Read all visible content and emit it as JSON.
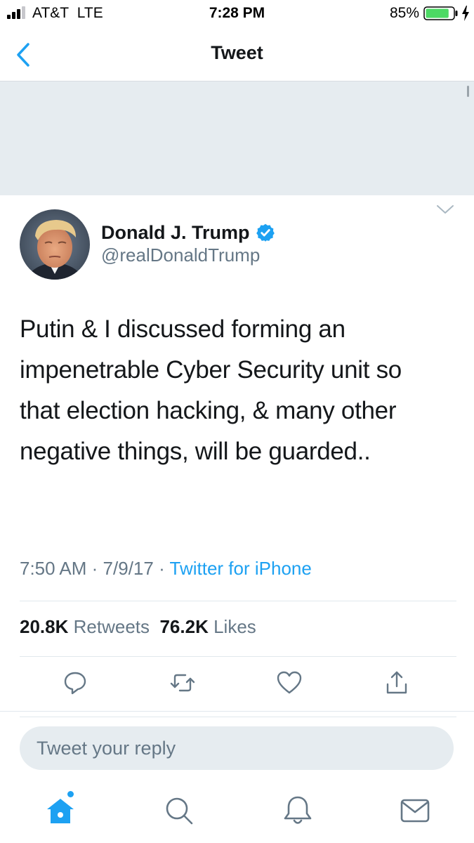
{
  "status_bar": {
    "carrier": "AT&T",
    "network": "LTE",
    "time": "7:28 PM",
    "battery_percent": "85%",
    "battery_level": 0.85,
    "battery_color": "#4cd964"
  },
  "nav": {
    "title": "Tweet",
    "back_icon": "chevron-left-icon"
  },
  "tweet": {
    "display_name": "Donald J. Trump",
    "verified": true,
    "handle": "@realDonaldTrump",
    "text": "Putin & I discussed forming an impenetrable Cyber Security unit so that election hacking, & many other negative things, will be guarded..",
    "time": "7:50 AM",
    "date": "7/9/17",
    "source": "Twitter for iPhone",
    "separator": "·"
  },
  "stats": {
    "retweets_count": "20.8K",
    "retweets_label": "Retweets",
    "likes_count": "76.2K",
    "likes_label": "Likes"
  },
  "actions": [
    {
      "name": "reply",
      "icon": "reply-icon"
    },
    {
      "name": "retweet",
      "icon": "retweet-icon"
    },
    {
      "name": "like",
      "icon": "heart-icon"
    },
    {
      "name": "share",
      "icon": "share-icon"
    }
  ],
  "reply": {
    "placeholder": "Tweet your reply"
  },
  "tab_bar": [
    {
      "name": "home",
      "icon": "home-icon",
      "active": true
    },
    {
      "name": "search",
      "icon": "search-icon",
      "active": false
    },
    {
      "name": "notifications",
      "icon": "bell-icon",
      "active": false
    },
    {
      "name": "messages",
      "icon": "mail-icon",
      "active": false
    }
  ],
  "colors": {
    "accent": "#1da1f2",
    "secondary_text": "#657786",
    "primary_text": "#14171a",
    "banner": "#e6ecf0",
    "verified_badge": "#1da1f2"
  }
}
